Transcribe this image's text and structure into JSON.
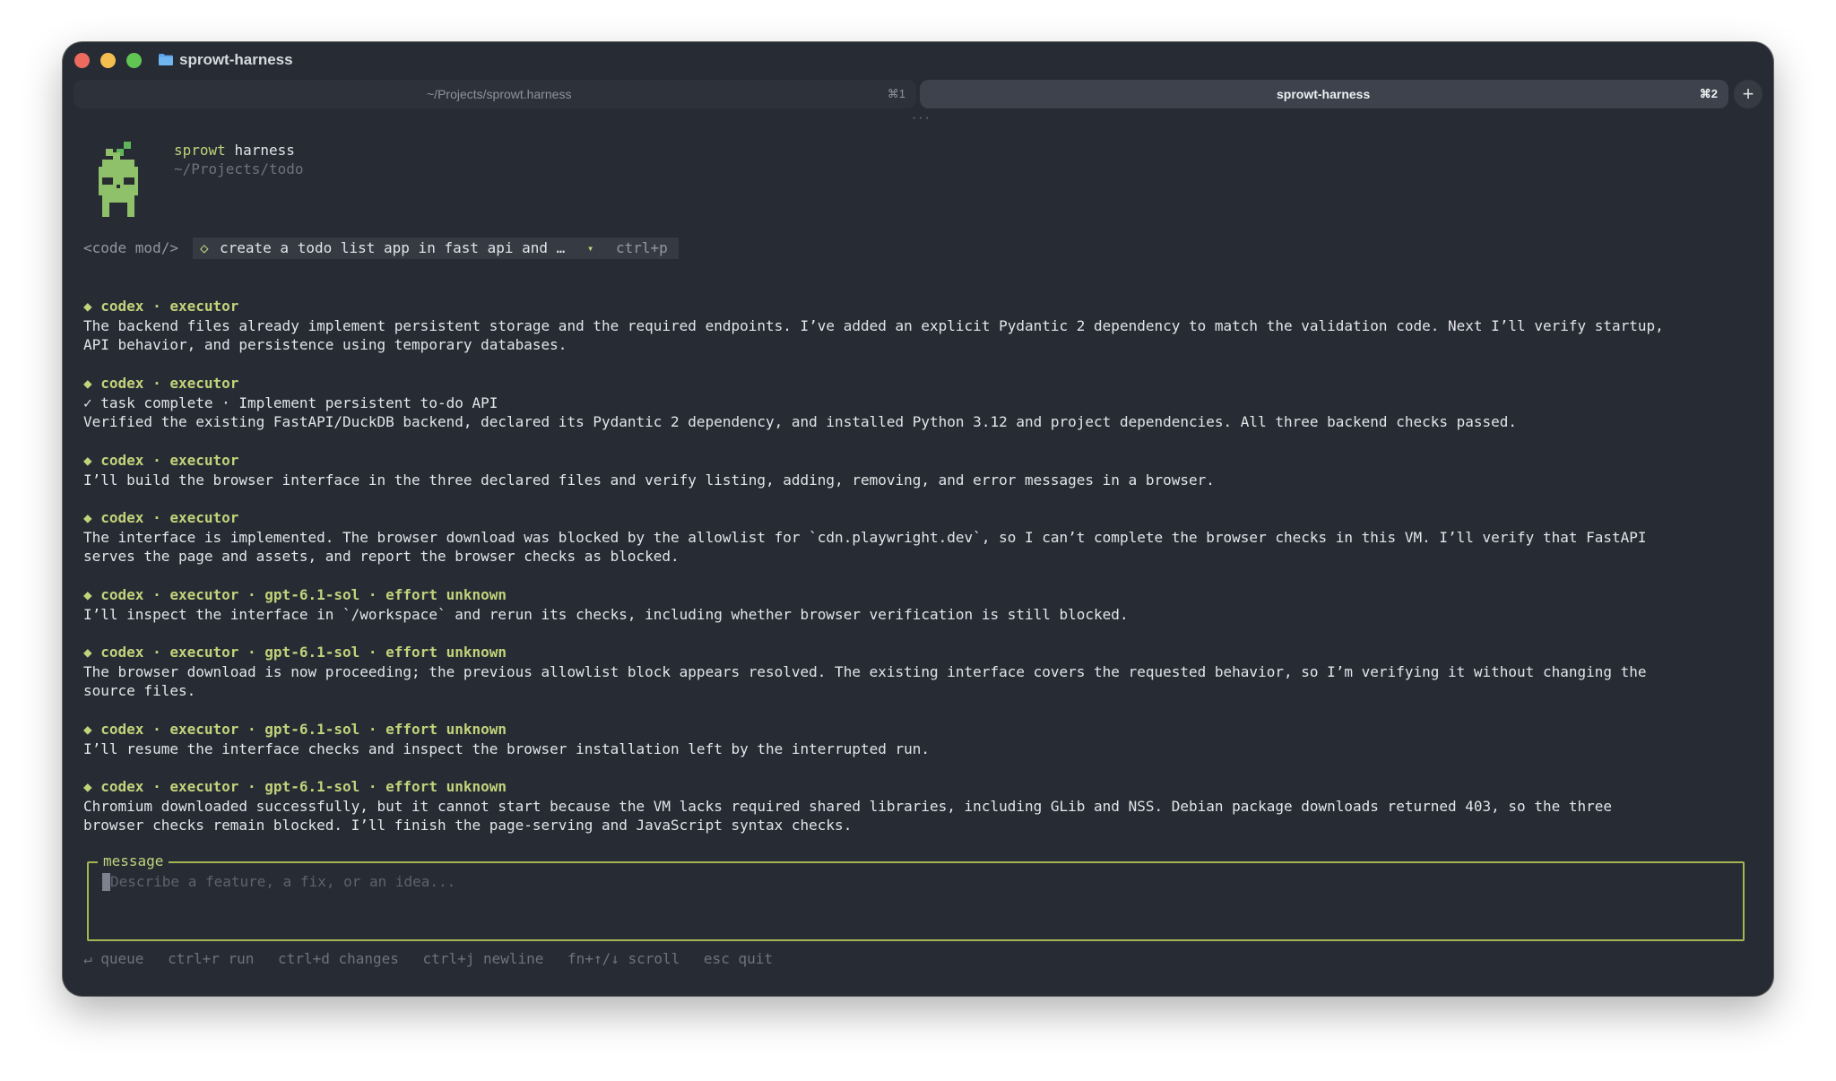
{
  "window": {
    "title": "sprowt-harness",
    "tabs": [
      {
        "label": "~/Projects/sprowt.harness",
        "shortcut": "⌘1",
        "active": false
      },
      {
        "label": "sprowt-harness",
        "shortcut": "⌘2",
        "active": true
      }
    ],
    "new_tab_label": "+",
    "drag_handle": "···"
  },
  "header": {
    "name_part1": "sprowt",
    "name_part2": "harness",
    "path": "~/Projects/todo"
  },
  "command": {
    "prefix": "<code mod/>",
    "diamond": "◇",
    "prompt": "create a todo list app in fast api and …",
    "dropdown_marker": "▾",
    "shortcut": "ctrl+p"
  },
  "messages": [
    {
      "header": "◆ codex · executor",
      "body": "The backend files already implement persistent storage and the required endpoints. I’ve added an explicit Pydantic 2 dependency to match the validation code. Next I’ll verify startup,\nAPI behavior, and persistence using temporary databases."
    },
    {
      "header": "◆ codex · executor",
      "task": "✓ task complete · Implement persistent to-do API",
      "body": "Verified the existing FastAPI/DuckDB backend, declared its Pydantic 2 dependency, and installed Python 3.12 and project dependencies. All three backend checks passed."
    },
    {
      "header": "◆ codex · executor",
      "body": "I’ll build the browser interface in the three declared files and verify listing, adding, removing, and error messages in a browser."
    },
    {
      "header": "◆ codex · executor",
      "body": "The interface is implemented. The browser download was blocked by the allowlist for `cdn.playwright.dev`, so I can’t complete the browser checks in this VM. I’ll verify that FastAPI\nserves the page and assets, and report the browser checks as blocked."
    },
    {
      "header": "◆ codex · executor · gpt-6.1-sol · effort unknown",
      "body": "I’ll inspect the interface in `/workspace` and rerun its checks, including whether browser verification is still blocked."
    },
    {
      "header": "◆ codex · executor · gpt-6.1-sol · effort unknown",
      "body": "The browser download is now proceeding; the previous allowlist block appears resolved. The existing interface covers the requested behavior, so I’m verifying it without changing the\nsource files."
    },
    {
      "header": "◆ codex · executor · gpt-6.1-sol · effort unknown",
      "body": "I’ll resume the interface checks and inspect the browser installation left by the interrupted run."
    },
    {
      "header": "◆ codex · executor · gpt-6.1-sol · effort unknown",
      "body": "Chromium downloaded successfully, but it cannot start because the VM lacks required shared libraries, including GLib and NSS. Debian package downloads returned 403, so the three\nbrowser checks remain blocked. I’ll finish the page-serving and JavaScript syntax checks."
    }
  ],
  "input": {
    "legend": "message",
    "value": "",
    "placeholder": "Describe a feature, a fix, or an idea..."
  },
  "footer": {
    "hints": [
      "↵ queue",
      "ctrl+r run",
      "ctrl+d changes",
      "ctrl+j newline",
      "fn+↑/↓ scroll",
      "esc quit"
    ]
  },
  "colors": {
    "window_bg": "#272b34",
    "accent": "#c3d37a",
    "text": "#e3e5e9",
    "muted": "#6d737e",
    "input_border": "#a5b552"
  },
  "icons": {
    "traffic_lights": [
      "close-icon",
      "minimize-icon",
      "zoom-icon"
    ],
    "folder": "folder-icon",
    "mascot": "sprout-mascot-icon"
  }
}
